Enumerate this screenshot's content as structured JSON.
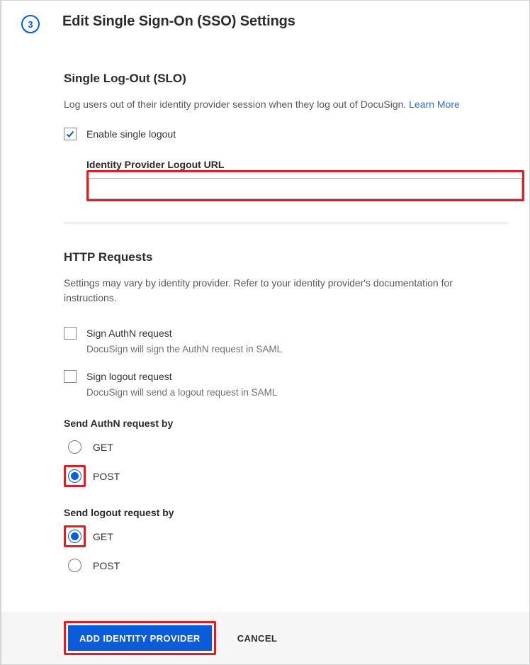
{
  "step_number": "3",
  "page_title": "Edit Single Sign-On (SSO) Settings",
  "slo": {
    "heading": "Single Log-Out (SLO)",
    "description": "Log users out of their identity provider session when they log out of DocuSign.",
    "learn_more": "Learn More",
    "checkbox_label": "Enable single logout",
    "checkbox_checked": true,
    "field_label": "Identity Provider Logout URL",
    "field_value": ""
  },
  "http": {
    "heading": "HTTP Requests",
    "description": "Settings may vary by identity provider. Refer to your identity provider's documentation for instructions.",
    "sign_authn": {
      "label": "Sign AuthN request",
      "hint": "DocuSign will sign the AuthN request in SAML",
      "checked": false
    },
    "sign_logout": {
      "label": "Sign logout request",
      "hint": "DocuSign will send a logout request in SAML",
      "checked": false
    },
    "send_authn": {
      "label": "Send AuthN request by",
      "options": [
        "GET",
        "POST"
      ],
      "selected": "POST"
    },
    "send_logout": {
      "label": "Send logout request by",
      "options": [
        "GET",
        "POST"
      ],
      "selected": "GET"
    }
  },
  "footer": {
    "primary": "ADD IDENTITY PROVIDER",
    "cancel": "CANCEL"
  }
}
